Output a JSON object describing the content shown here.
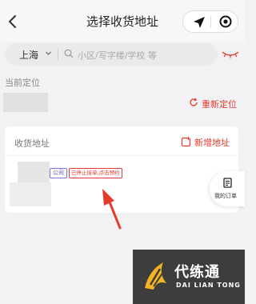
{
  "header": {
    "title": "选择收货地址",
    "back_icon": "chevron-left-icon",
    "nav_icon": "navigation-arrow-icon",
    "target_icon": "target-icon"
  },
  "search": {
    "city": "上海",
    "placeholder": "小区/写字楼/学校 等"
  },
  "current_location": {
    "label": "当前定位",
    "relocate_label": "重新定位"
  },
  "addresses": {
    "title": "收货地址",
    "add_label": "新增地址",
    "items": [
      {
        "tag": "公司",
        "status": "已停止接单,点击预约"
      }
    ]
  },
  "floating": {
    "orders_label": "我的订单"
  },
  "watermark": {
    "cn": "代练通",
    "en": "DAI LIAN TONG"
  },
  "colors": {
    "accent": "#e63a2e",
    "tag_company": "#5a52c4",
    "arrow": "#e63a2e"
  }
}
